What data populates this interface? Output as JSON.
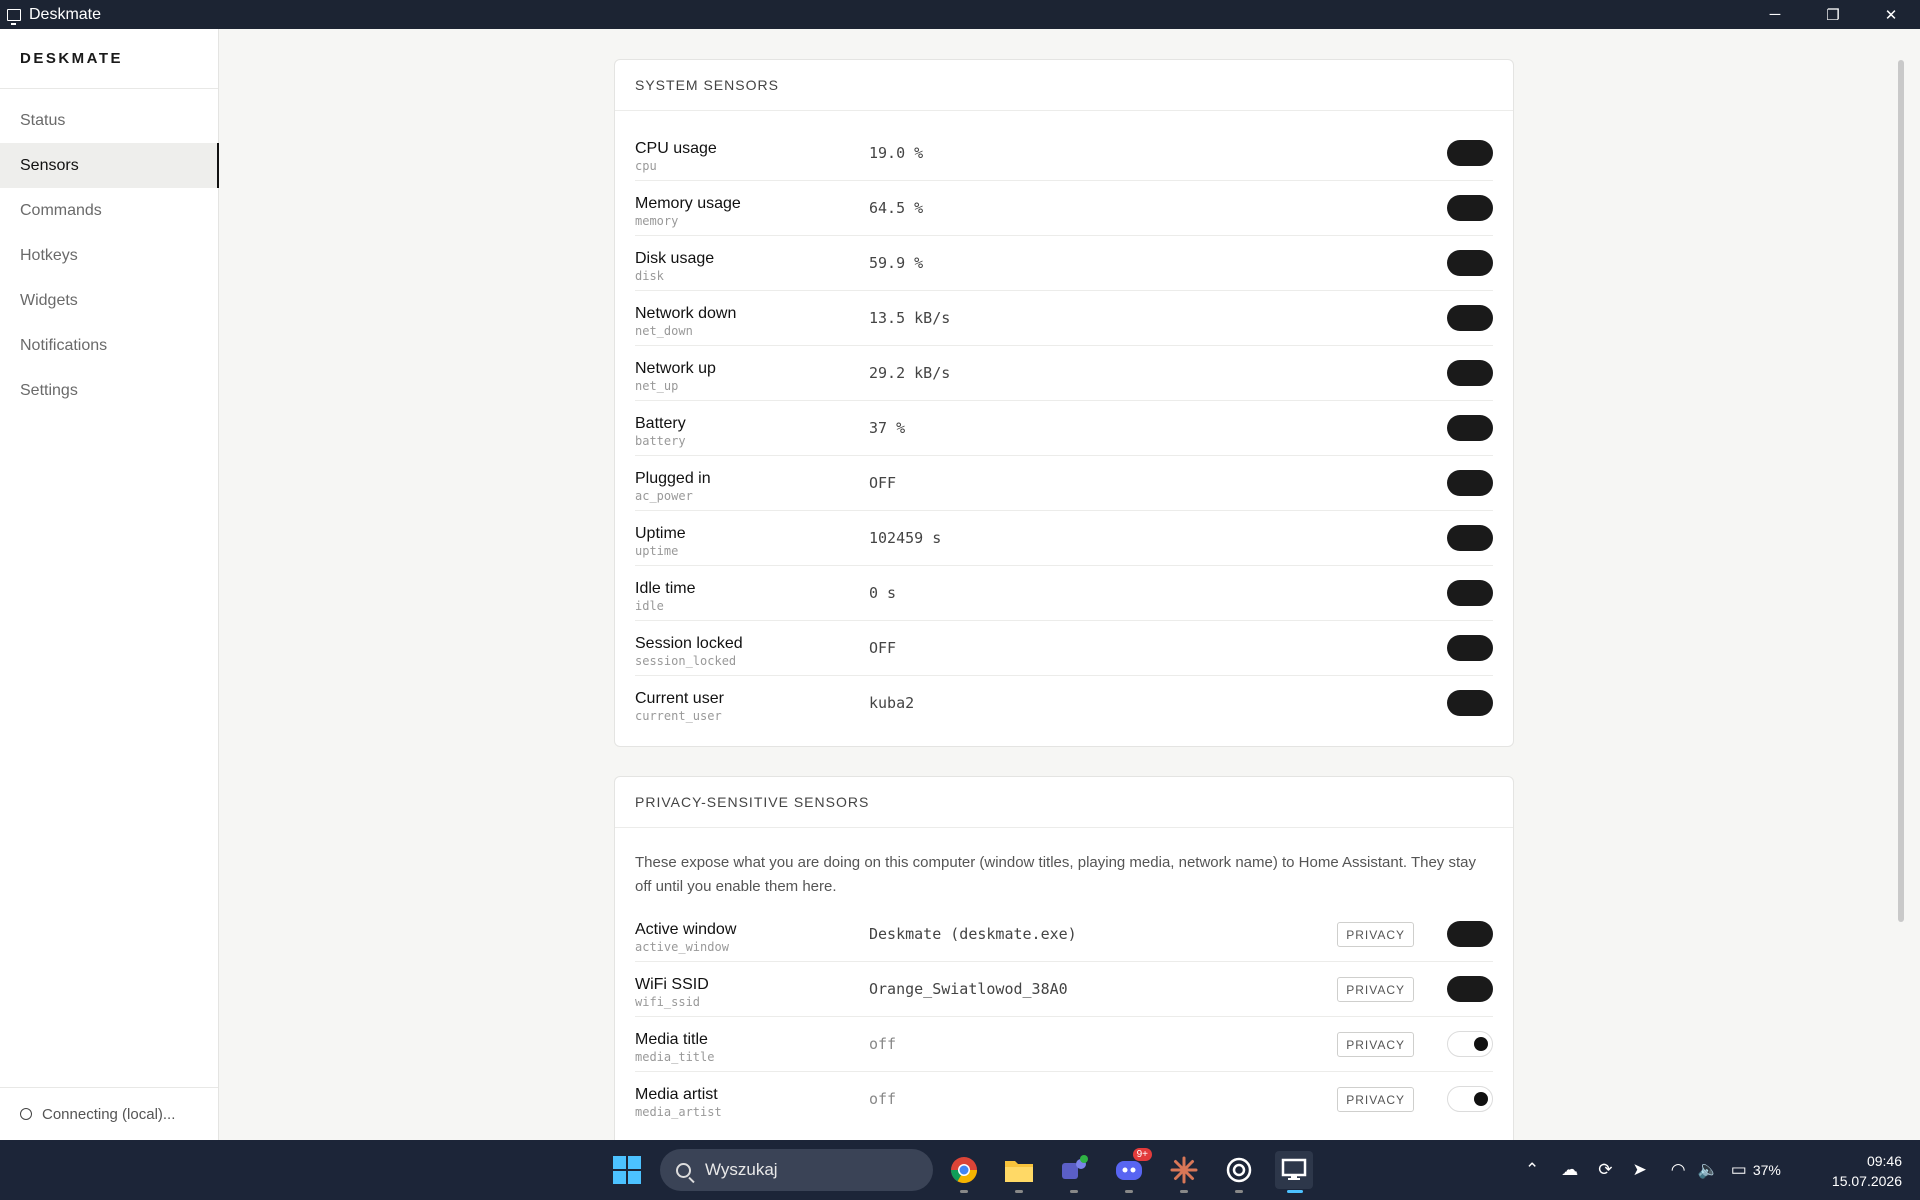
{
  "window": {
    "title": "Deskmate",
    "minimize": "─",
    "maximize": "❐",
    "close": "✕"
  },
  "sidebar": {
    "brand": "DESKMATE",
    "items": [
      {
        "label": "Status"
      },
      {
        "label": "Sensors",
        "active": true
      },
      {
        "label": "Commands"
      },
      {
        "label": "Hotkeys"
      },
      {
        "label": "Widgets"
      },
      {
        "label": "Notifications"
      },
      {
        "label": "Settings"
      }
    ],
    "connection": "Connecting (local)..."
  },
  "system": {
    "heading": "SYSTEM SENSORS",
    "rows": [
      {
        "name": "CPU usage",
        "key": "cpu",
        "value": "19.0 %",
        "enabled": true
      },
      {
        "name": "Memory usage",
        "key": "memory",
        "value": "64.5 %",
        "enabled": true
      },
      {
        "name": "Disk usage",
        "key": "disk",
        "value": "59.9 %",
        "enabled": true
      },
      {
        "name": "Network down",
        "key": "net_down",
        "value": "13.5 kB/s",
        "enabled": true
      },
      {
        "name": "Network up",
        "key": "net_up",
        "value": "29.2 kB/s",
        "enabled": true
      },
      {
        "name": "Battery",
        "key": "battery",
        "value": "37 %",
        "enabled": true
      },
      {
        "name": "Plugged in",
        "key": "ac_power",
        "value": "OFF",
        "enabled": true
      },
      {
        "name": "Uptime",
        "key": "uptime",
        "value": "102459 s",
        "enabled": true
      },
      {
        "name": "Idle time",
        "key": "idle",
        "value": "0 s",
        "enabled": true
      },
      {
        "name": "Session locked",
        "key": "session_locked",
        "value": "OFF",
        "enabled": true
      },
      {
        "name": "Current user",
        "key": "current_user",
        "value": "kuba2",
        "enabled": true
      }
    ]
  },
  "privacy": {
    "heading": "PRIVACY-SENSITIVE SENSORS",
    "description": "These expose what you are doing on this computer (window titles, playing media, network name) to Home Assistant. They stay off until you enable them here.",
    "badge_label": "PRIVACY",
    "rows": [
      {
        "name": "Active window",
        "key": "active_window",
        "value": "Deskmate (deskmate.exe)",
        "enabled": true
      },
      {
        "name": "WiFi SSID",
        "key": "wifi_ssid",
        "value": "Orange_Swiatlowod_38A0",
        "enabled": true
      },
      {
        "name": "Media title",
        "key": "media_title",
        "value": "off",
        "enabled": false
      },
      {
        "name": "Media artist",
        "key": "media_artist",
        "value": "off",
        "enabled": false
      }
    ]
  },
  "taskbar": {
    "search_placeholder": "Wyszukaj",
    "discord_badge": "9+",
    "battery": "37%",
    "time": "09:46",
    "date": "15.07.2026",
    "colors": {
      "accent": "#4cc2ff",
      "background": "#1c2538"
    }
  }
}
